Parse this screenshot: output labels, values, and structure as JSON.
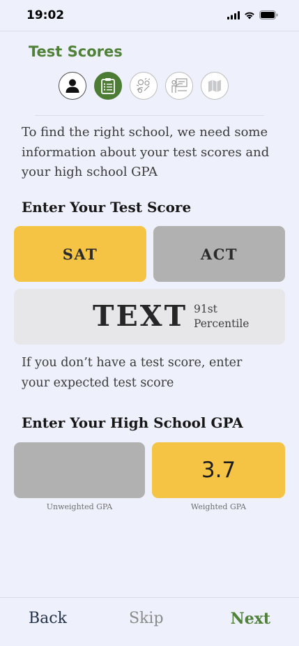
{
  "status_bar": {
    "time": "19:02",
    "icons": [
      "cellular-signal-icon",
      "wifi-icon",
      "battery-icon"
    ]
  },
  "header": {
    "title": "Test Scores",
    "steps": [
      {
        "icon": "person-icon",
        "state": "completed"
      },
      {
        "icon": "clipboard-icon",
        "state": "active"
      },
      {
        "icon": "activities-icon",
        "state": "pending"
      },
      {
        "icon": "teacher-icon",
        "state": "pending"
      },
      {
        "icon": "map-icon",
        "state": "pending"
      }
    ]
  },
  "intro_text": "To find the right school, we need some information about your test scores and your high school GPA",
  "test_score": {
    "heading": "Enter Your Test Score",
    "options": [
      {
        "label": "SAT",
        "selected": true
      },
      {
        "label": "ACT",
        "selected": false
      }
    ],
    "score_value": "TEXT",
    "percentile_line1": "91st",
    "percentile_line2": "Percentile",
    "hint": "If you don’t have a test score, enter your expected test score"
  },
  "gpa": {
    "heading": "Enter Your High School GPA",
    "unweighted": {
      "value": "",
      "caption": "Unweighted GPA",
      "selected": false
    },
    "weighted": {
      "value": "3.7",
      "caption": "Weighted GPA",
      "selected": true
    }
  },
  "nav": {
    "back": "Back",
    "skip": "Skip",
    "next": "Next"
  },
  "colors": {
    "background": "#eef1fb",
    "brand_green": "#4f8138",
    "selected_yellow": "#f5c444",
    "unselected_gray": "#b1b1b1"
  }
}
